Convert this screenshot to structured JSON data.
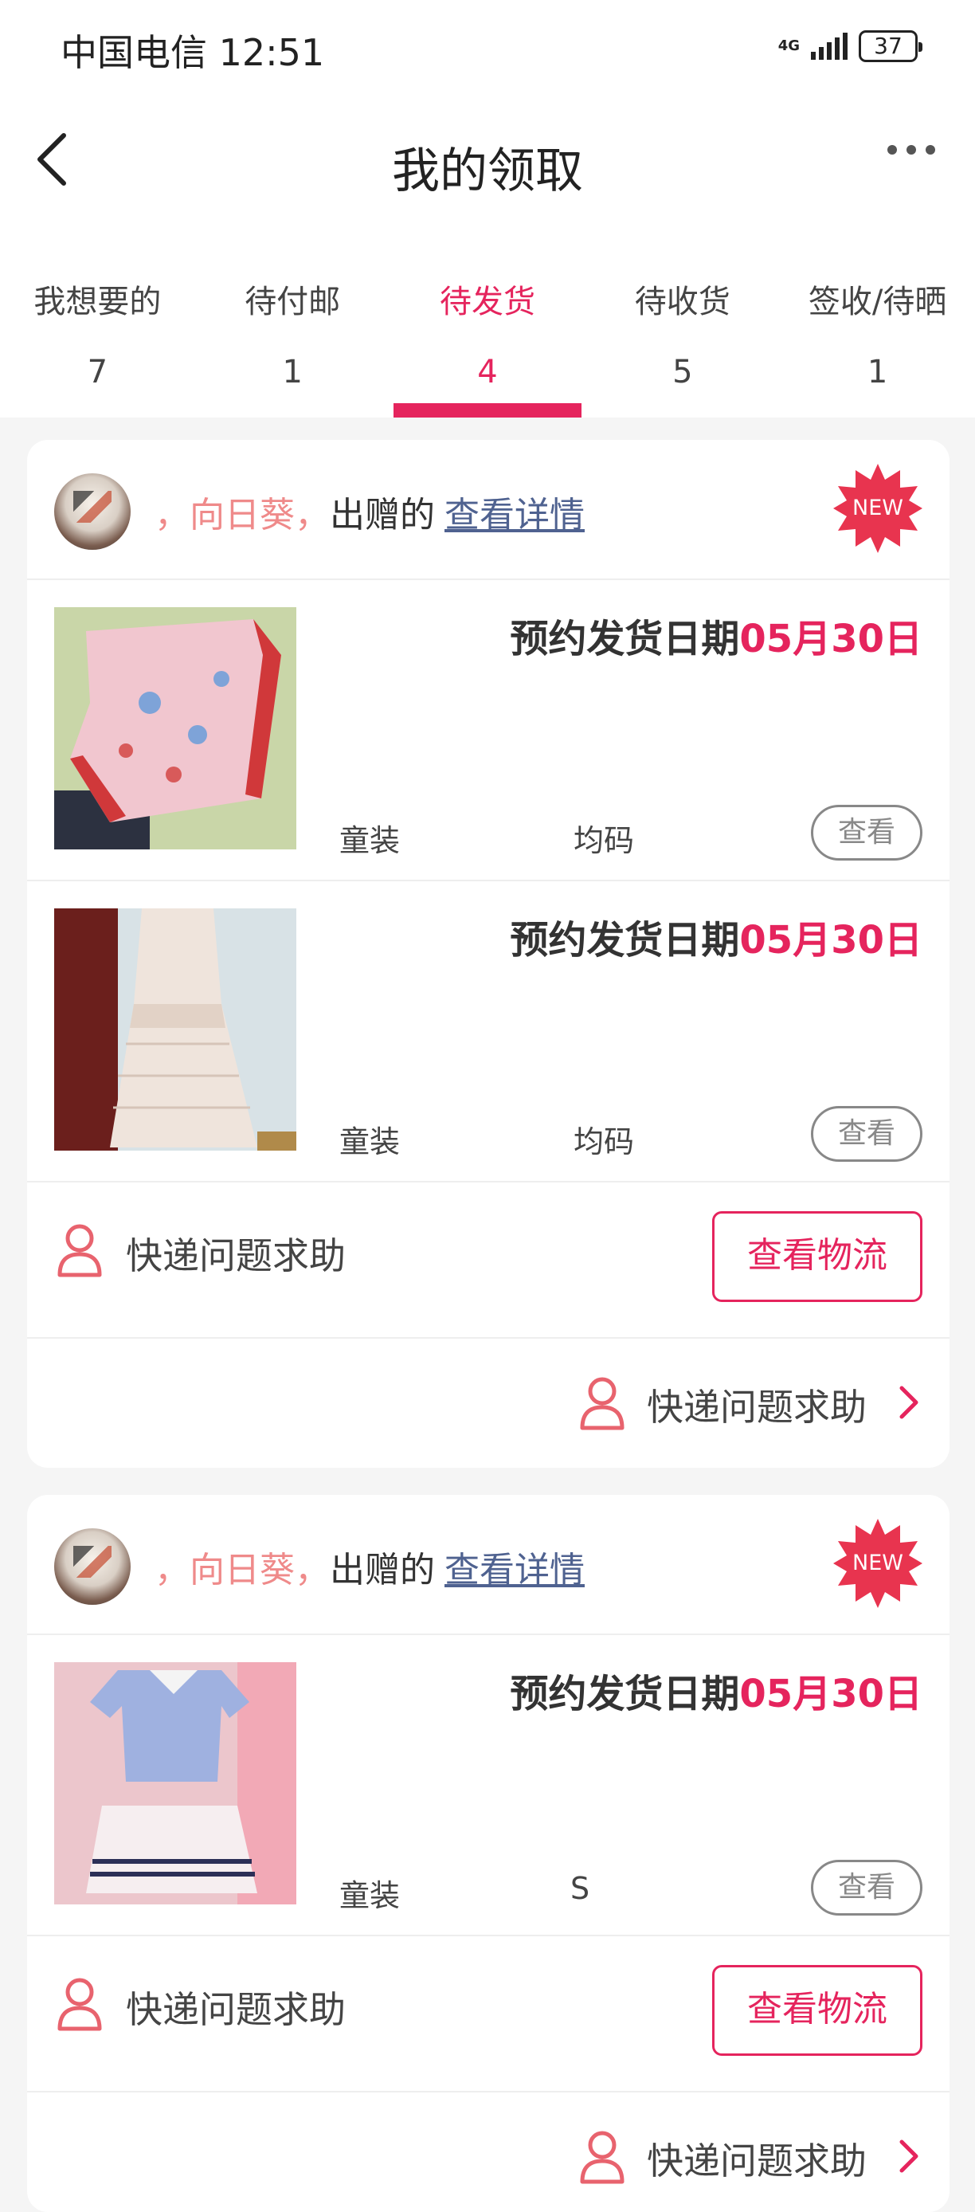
{
  "status_bar": {
    "carrier_time": "中国电信 12:51",
    "network": "4G",
    "battery": "37"
  },
  "nav": {
    "title": "我的领取"
  },
  "tabs": [
    {
      "label": "我想要的",
      "count": "7"
    },
    {
      "label": "待付邮",
      "count": "1"
    },
    {
      "label": "待发货",
      "count": "4",
      "active": true
    },
    {
      "label": "待收货",
      "count": "5"
    },
    {
      "label": "签收/待晒",
      "count": "1"
    }
  ],
  "cards": [
    {
      "donor": {
        "prefix": "，向日葵，",
        "gave": "出赠的",
        "detail_link": "查看详情",
        "badge": "NEW"
      },
      "items": [
        {
          "ship_label": "预约发货日期",
          "ship_date": "05月30日",
          "category": "童装",
          "size": "均码",
          "view_label": "查看"
        },
        {
          "ship_label": "预约发货日期",
          "ship_date": "05月30日",
          "category": "童装",
          "size": "均码",
          "view_label": "查看"
        }
      ],
      "help_label": "快递问题求助",
      "logistics_label": "查看物流",
      "footer_help_label": "快递问题求助"
    },
    {
      "donor": {
        "prefix": "，向日葵，",
        "gave": "出赠的",
        "detail_link": "查看详情",
        "badge": "NEW"
      },
      "items": [
        {
          "ship_label": "预约发货日期",
          "ship_date": "05月30日",
          "category": "童装",
          "size": "S",
          "view_label": "查看"
        }
      ],
      "help_label": "快递问题求助",
      "logistics_label": "查看物流",
      "footer_help_label": "快递问题求助"
    }
  ],
  "colors": {
    "accent": "#e5245d",
    "donor_name": "#ef8a8a",
    "link": "#4f6290"
  }
}
